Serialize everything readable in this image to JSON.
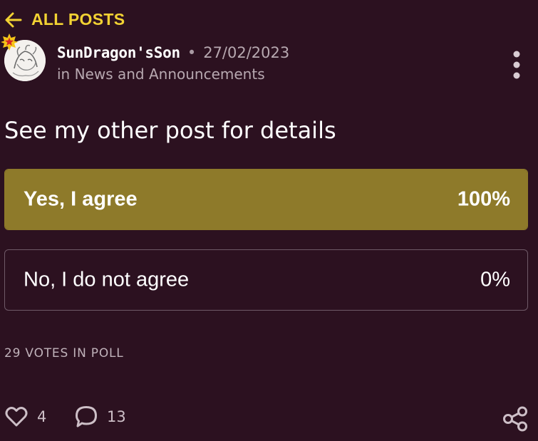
{
  "nav": {
    "back_label": "ALL POSTS"
  },
  "post": {
    "author": "SunDragon'sSon",
    "separator": "•",
    "date": "27/02/2023",
    "category": "in News and Announcements",
    "title": "See my other post for details"
  },
  "poll": {
    "options": [
      {
        "label": "Yes, I agree",
        "percent_label": "100%",
        "percent": 100
      },
      {
        "label": "No, I do not agree",
        "percent_label": "0%",
        "percent": 0
      }
    ],
    "votes_label": "29 VOTES IN POLL"
  },
  "footer": {
    "likes": "4",
    "comments": "13"
  },
  "colors": {
    "background": "#2c1120",
    "accent": "#f2d233",
    "winning_fill": "#8e7a2a",
    "option_border": "#6f5a68",
    "muted_text": "#b7a8b0"
  },
  "icons": {
    "back": "arrow-left-icon",
    "badge": "star-badge-icon",
    "menu": "more-vertical-icon",
    "like": "heart-icon",
    "comment": "comment-icon",
    "share": "share-icon"
  }
}
